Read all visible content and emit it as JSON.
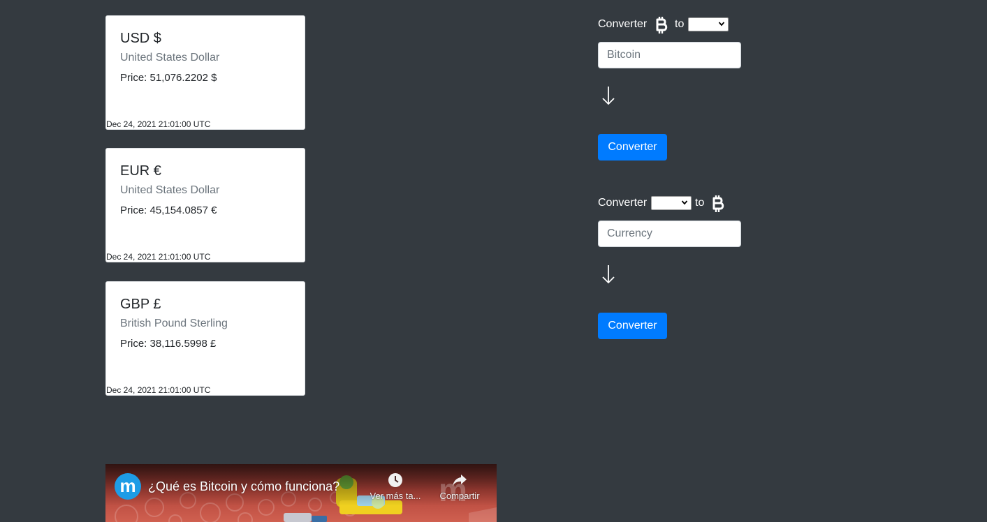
{
  "cards": [
    {
      "title": "USD $",
      "subtitle": "United States Dollar",
      "price": "Price: 51,076.2202 $",
      "timestamp": "Dec 24, 2021 21:01:00 UTC"
    },
    {
      "title": "EUR €",
      "subtitle": "United States Dollar",
      "price": "Price: 45,154.0857 €",
      "timestamp": "Dec 24, 2021 21:01:00 UTC"
    },
    {
      "title": "GBP £",
      "subtitle": "British Pound Sterling",
      "price": "Price: 38,116.5998 £",
      "timestamp": "Dec 24, 2021 21:01:00 UTC"
    }
  ],
  "converter_btc_to_currency": {
    "label": "Converter",
    "to_label": "to",
    "from_icon": "bitcoin-icon",
    "currency_select_value": "",
    "input_placeholder": "Bitcoin",
    "arrow_icon": "down-arrow-icon",
    "button_label": "Converter"
  },
  "converter_currency_to_btc": {
    "label": "Converter",
    "to_label": "to",
    "to_icon": "bitcoin-icon",
    "currency_select_value": "",
    "input_placeholder": "Currency",
    "arrow_icon": "down-arrow-icon",
    "button_label": "Converter"
  },
  "video": {
    "channel_avatar_letter": "m",
    "title": "¿Qué es Bitcoin y cómo funciona?",
    "watch_later_label": "Ver más ta...",
    "share_label": "Compartir",
    "watermark_letter": "m"
  },
  "colors": {
    "page_background": "#343a40",
    "card_background": "#ffffff",
    "button_primary": "#007bff",
    "muted_text": "#6c757d"
  }
}
